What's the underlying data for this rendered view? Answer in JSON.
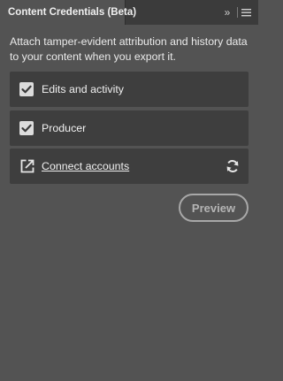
{
  "panel": {
    "tab_title": "Content Credentials (Beta)",
    "description": "Attach tamper-evident attribution and history data to your content when you export it."
  },
  "header": {
    "collapse_glyph": "»",
    "collapse_icon": "double-chevron-right-icon",
    "menu_icon": "hamburger-menu-icon"
  },
  "options": {
    "edits": {
      "label": "Edits and activity",
      "checked": true
    },
    "producer": {
      "label": "Producer",
      "checked": true
    }
  },
  "connect": {
    "label": "Connect accounts",
    "link_icon": "external-link-icon",
    "refresh_icon": "refresh-icon"
  },
  "actions": {
    "preview_label": "Preview",
    "preview_enabled": false
  },
  "colors": {
    "panel_bg": "#535353",
    "row_bg": "#3e3e3e",
    "topbar_bg": "#3b3b3b",
    "text": "#f0f0f0",
    "disabled_button": "#a8a8a8"
  }
}
